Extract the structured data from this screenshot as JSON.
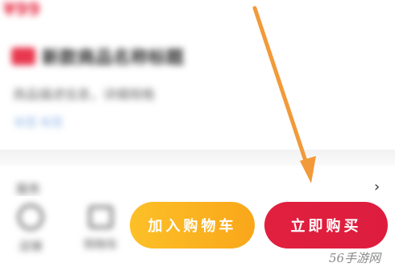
{
  "product": {
    "price": "¥99",
    "title": "新款商品名称标题",
    "subtitle": "商品描述信息，详细规格",
    "tagline": "标签  标签"
  },
  "service": {
    "label": "服务"
  },
  "bottom_bar": {
    "store_label": "店铺",
    "cart_label": "购物车",
    "add_to_cart_label": "加入购物车",
    "buy_now_label": "立即购买"
  },
  "watermark": "56手游网",
  "colors": {
    "accent_red": "#e0203e",
    "accent_yellow": "#fcc028",
    "arrow_orange": "#f29a3a"
  },
  "annotation": {
    "icon": "arrow-down-right-icon"
  }
}
